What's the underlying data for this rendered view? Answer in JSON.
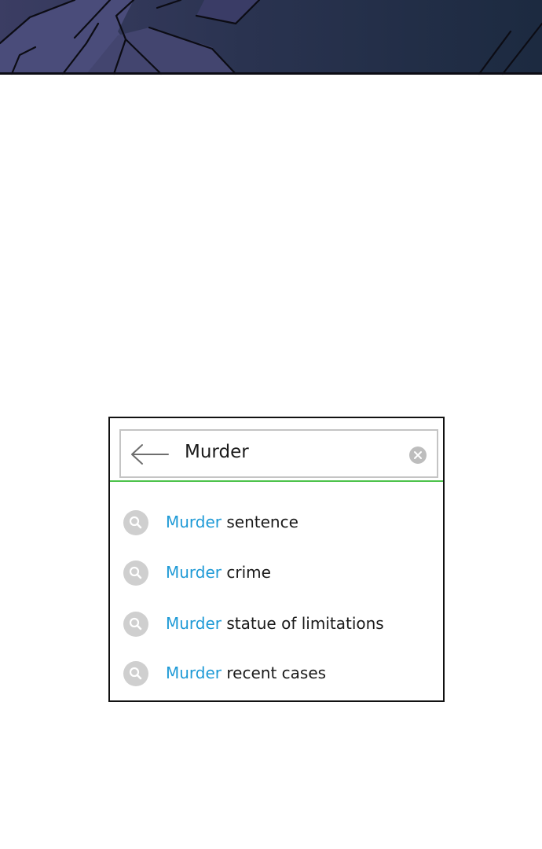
{
  "search": {
    "query": "Murder",
    "accent_color": "#4cc24a",
    "match_color": "#1e9ad6"
  },
  "suggestions": [
    {
      "match": "Murder",
      "rest": " sentence",
      "icon": "search-icon"
    },
    {
      "match": "Murder",
      "rest": " crime",
      "icon": "search-icon"
    },
    {
      "match": "Murder",
      "rest": " statue of limitations",
      "icon": "search-icon"
    },
    {
      "match": "Murder",
      "rest": " recent cases",
      "icon": "search-icon"
    }
  ],
  "icons": {
    "back": "arrow-left-icon",
    "clear": "close-circle-icon"
  }
}
